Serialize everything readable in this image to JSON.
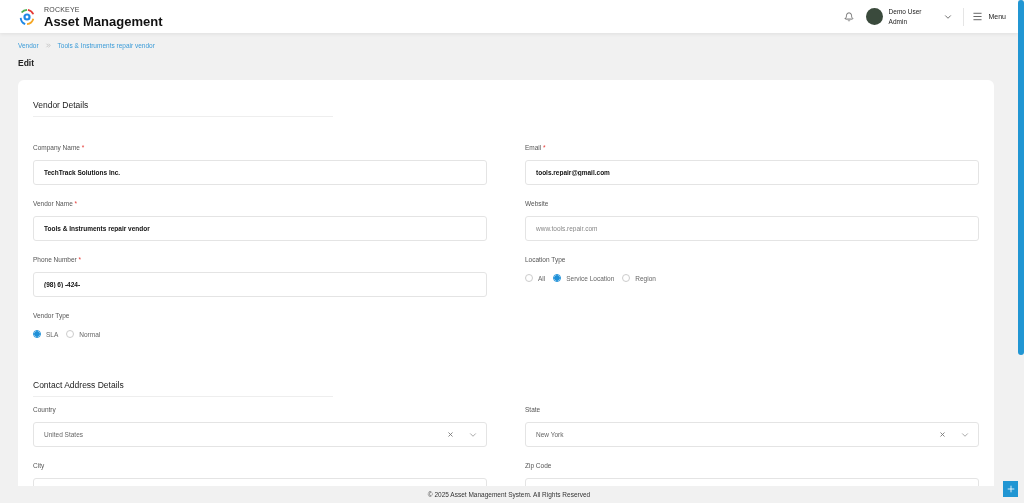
{
  "header": {
    "brand_small": "ROCKEYE",
    "brand": "Asset Management",
    "user_name": "Demo User",
    "user_role": "Admin",
    "menu_label": "Menu"
  },
  "breadcrumb": [
    {
      "label": "Vendor"
    },
    {
      "label": "Tools & Instruments repair vendor"
    }
  ],
  "page_title": "Edit",
  "sections": [
    {
      "title": "Vendor Details",
      "fields": [
        {
          "kind": "text",
          "label": "Company Name",
          "required_mark": "*",
          "value": "TechTrack Solutions Inc."
        },
        {
          "kind": "text",
          "label": "Email",
          "required_mark": "*",
          "value": "tools.repair@gmail.com"
        },
        {
          "kind": "text",
          "label": "Vendor Name",
          "required_mark": "*",
          "value": "Tools & Instruments repair vendor"
        },
        {
          "kind": "text",
          "label": "Website",
          "placeholder": "www.tools.repair.com"
        },
        {
          "kind": "text",
          "label": "Phone Number",
          "required_mark": "*",
          "value": "(98) 6) -424-"
        },
        {
          "kind": "radio",
          "label": "Location Type",
          "options": [
            {
              "label": "All",
              "selected": false
            },
            {
              "label": "Service Location",
              "selected": true
            },
            {
              "label": "Region",
              "selected": false
            }
          ]
        },
        {
          "kind": "radio",
          "label": "Vendor Type",
          "options": [
            {
              "label": "SLA",
              "selected": true
            },
            {
              "label": "Normal",
              "selected": false
            }
          ]
        }
      ]
    },
    {
      "title": "Contact Address Details",
      "fields": [
        {
          "kind": "select",
          "label": "Country",
          "value": "United States"
        },
        {
          "kind": "select",
          "label": "State",
          "value": "New York"
        },
        {
          "kind": "text",
          "label": "City"
        },
        {
          "kind": "text",
          "label": "Zip Code"
        }
      ]
    }
  ],
  "footer": "© 2025 Asset Management System. All Rights Reserved"
}
